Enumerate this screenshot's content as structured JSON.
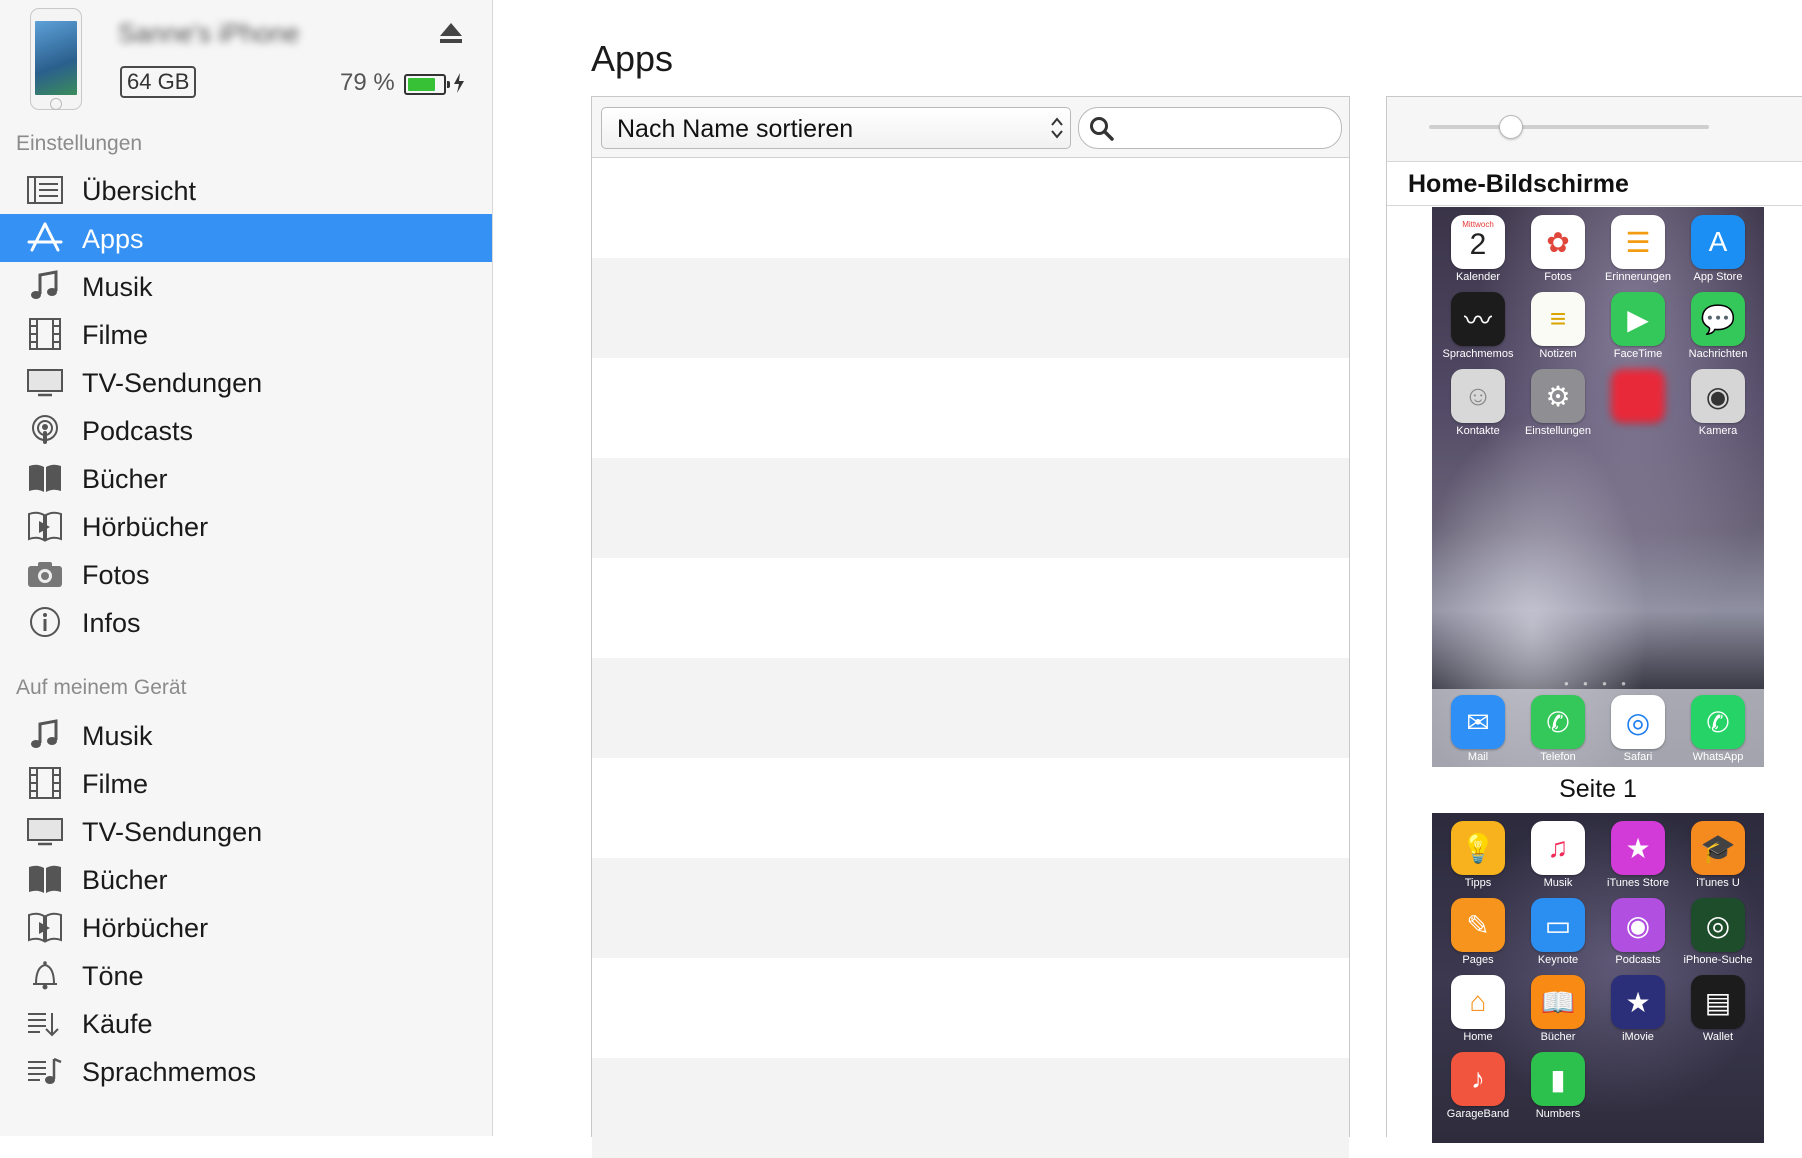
{
  "device": {
    "name": "Sanne's iPhone",
    "capacity": "64 GB",
    "battery_percent": "79 %",
    "battery_level": 0.79
  },
  "sidebar": {
    "settings_title": "Einstellungen",
    "settings_items": [
      {
        "label": "Übersicht",
        "icon": "summary-icon"
      },
      {
        "label": "Apps",
        "icon": "app-store-icon",
        "selected": true
      },
      {
        "label": "Musik",
        "icon": "music-note-icon"
      },
      {
        "label": "Filme",
        "icon": "film-icon"
      },
      {
        "label": "TV-Sendungen",
        "icon": "tv-icon"
      },
      {
        "label": "Podcasts",
        "icon": "podcast-icon"
      },
      {
        "label": "Bücher",
        "icon": "book-icon"
      },
      {
        "label": "Hörbücher",
        "icon": "audiobook-icon"
      },
      {
        "label": "Fotos",
        "icon": "camera-icon"
      },
      {
        "label": "Infos",
        "icon": "info-icon"
      }
    ],
    "device_title": "Auf meinem Gerät",
    "device_items": [
      {
        "label": "Musik",
        "icon": "music-note-icon"
      },
      {
        "label": "Filme",
        "icon": "film-icon"
      },
      {
        "label": "TV-Sendungen",
        "icon": "tv-icon"
      },
      {
        "label": "Bücher",
        "icon": "book-icon"
      },
      {
        "label": "Hörbücher",
        "icon": "audiobook-icon"
      },
      {
        "label": "Töne",
        "icon": "bell-icon"
      },
      {
        "label": "Käufe",
        "icon": "purchases-icon"
      },
      {
        "label": "Sprachmemos",
        "icon": "voice-memo-icon"
      }
    ]
  },
  "main": {
    "title": "Apps",
    "sort_label": "Nach Name sortieren",
    "search_value": ""
  },
  "home_screens": {
    "title": "Home-Bildschirme",
    "page1_label": "Seite 1",
    "page1_apps": [
      {
        "name": "Kalender",
        "icon": "calendar-icon",
        "color": "#ffffff",
        "text": "2",
        "sub": "Mittwoch"
      },
      {
        "name": "Fotos",
        "icon": "photos-icon",
        "color": "#ffffff"
      },
      {
        "name": "Erinnerungen",
        "icon": "reminders-icon",
        "color": "#ffffff"
      },
      {
        "name": "App Store",
        "icon": "app-store-icon",
        "color": "#1c8ff5"
      },
      {
        "name": "Sprachmemos",
        "icon": "voice-memos-icon",
        "color": "#1c1c1c"
      },
      {
        "name": "Notizen",
        "icon": "notes-icon",
        "color": "#fbfbf6"
      },
      {
        "name": "FaceTime",
        "icon": "facetime-icon",
        "color": "#34c759"
      },
      {
        "name": "Nachrichten",
        "icon": "messages-icon",
        "color": "#34c759"
      },
      {
        "name": "Kontakte",
        "icon": "contacts-icon",
        "color": "#d8d8d8"
      },
      {
        "name": "Einstellungen",
        "icon": "settings-gear-icon",
        "color": "#8e8e93"
      },
      {
        "name": "",
        "icon": "blurred-app-icon",
        "color": "#e8293a"
      },
      {
        "name": "Kamera",
        "icon": "camera-icon",
        "color": "#d6d6d6"
      }
    ],
    "dock_apps": [
      {
        "name": "Mail",
        "icon": "mail-icon",
        "color": "#2e8ff7"
      },
      {
        "name": "Telefon",
        "icon": "phone-icon",
        "color": "#34c759"
      },
      {
        "name": "Safari",
        "icon": "safari-icon",
        "color": "#ffffff"
      },
      {
        "name": "WhatsApp",
        "icon": "whatsapp-icon",
        "color": "#25d366"
      }
    ],
    "page2_apps": [
      {
        "name": "Tipps",
        "icon": "tips-icon",
        "color": "#f7b21d"
      },
      {
        "name": "Musik",
        "icon": "music-icon",
        "color": "#ffffff"
      },
      {
        "name": "iTunes Store",
        "icon": "itunes-store-icon",
        "color": "#d23bd8"
      },
      {
        "name": "iTunes U",
        "icon": "itunes-u-icon",
        "color": "#f58a1f"
      },
      {
        "name": "Pages",
        "icon": "pages-icon",
        "color": "#f7941d"
      },
      {
        "name": "Keynote",
        "icon": "keynote-icon",
        "color": "#2b8ff2"
      },
      {
        "name": "Podcasts",
        "icon": "podcasts-icon",
        "color": "#b14fe0"
      },
      {
        "name": "iPhone-Suche",
        "icon": "find-iphone-icon",
        "color": "#1e4d2b"
      },
      {
        "name": "Home",
        "icon": "home-icon",
        "color": "#ffffff"
      },
      {
        "name": "Bücher",
        "icon": "books-icon",
        "color": "#f98a14"
      },
      {
        "name": "iMovie",
        "icon": "imovie-icon",
        "color": "#2b2f7a"
      },
      {
        "name": "Wallet",
        "icon": "wallet-icon",
        "color": "#1c1c1c"
      },
      {
        "name": "GarageBand",
        "icon": "garageband-icon",
        "color": "#f2553d"
      },
      {
        "name": "Numbers",
        "icon": "numbers-icon",
        "color": "#2cc04d"
      }
    ]
  },
  "colors": {
    "selection": "#3592f4",
    "sidebar_bg": "#f6f6f6",
    "battery_green": "#36c136"
  }
}
